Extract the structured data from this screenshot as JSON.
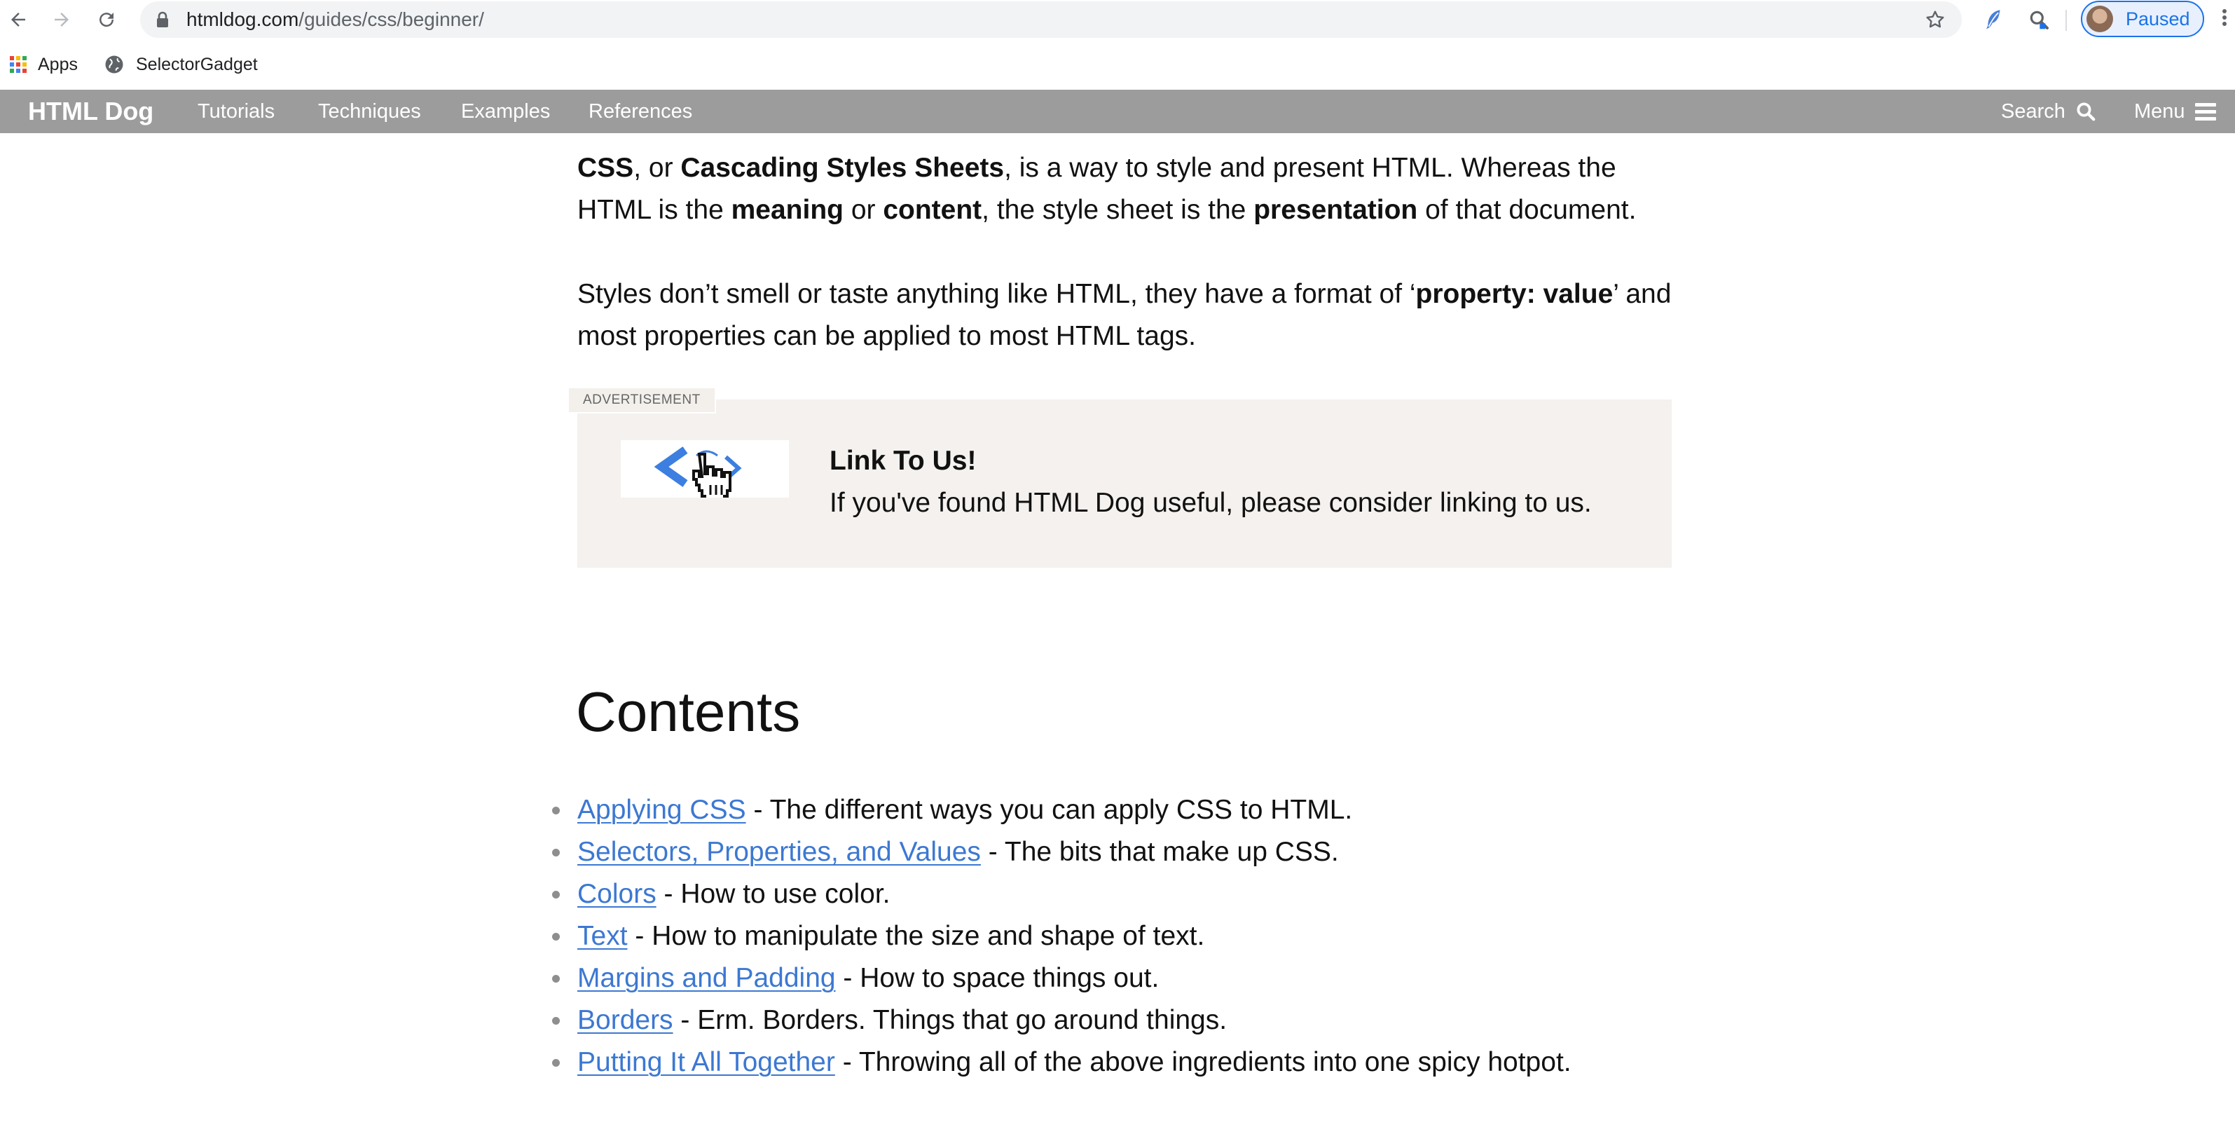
{
  "browser": {
    "url_host": "htmldog.com",
    "url_path": "/guides/css/beginner/",
    "profile_label": "Paused",
    "bookmarks": [
      {
        "label": "Apps",
        "icon": "apps-grid-icon"
      },
      {
        "label": "SelectorGadget",
        "icon": "globe-icon"
      }
    ]
  },
  "site_nav": {
    "brand": "HTML Dog",
    "links": [
      "Tutorials",
      "Techniques",
      "Examples",
      "References"
    ],
    "search_label": "Search",
    "menu_label": "Menu"
  },
  "article": {
    "intro": {
      "p1": [
        "CSS",
        ", or ",
        "Cascading Styles Sheets",
        ", is a way to style and present HTML. Whereas the HTML is the ",
        "meaning",
        " or ",
        "content",
        ", the style sheet is the ",
        "presentation",
        " of that document."
      ],
      "p2": [
        "Styles don’t smell or taste anything like HTML, they have a format of ‘",
        "property: value",
        "’ and most properties can be applied to most HTML tags."
      ]
    },
    "ad": {
      "tag": "ADVERTISEMENT",
      "title": "Link To Us!",
      "text": "If you've found HTML Dog useful, please consider linking to us."
    },
    "contents_title": "Contents",
    "toc": [
      {
        "link": "Applying CSS",
        "desc": " - The different ways you can apply CSS to HTML."
      },
      {
        "link": "Selectors, Properties, and Values",
        "desc": " - The bits that make up CSS."
      },
      {
        "link": "Colors",
        "desc": " - How to use color."
      },
      {
        "link": "Text",
        "desc": " - How to manipulate the size and shape of text."
      },
      {
        "link": "Margins and Padding",
        "desc": " - How to space things out."
      },
      {
        "link": "Borders",
        "desc": " - Erm. Borders. Things that go around things."
      },
      {
        "link": "Putting It All Together",
        "desc": " - Throwing all of the above ingredients into one spicy hotpot."
      }
    ]
  },
  "colors": {
    "nav_bg": "#9c9c9c",
    "link": "#3c78d2",
    "ad_bg": "#f4f1ee",
    "profile_accent": "#1a73e8"
  }
}
